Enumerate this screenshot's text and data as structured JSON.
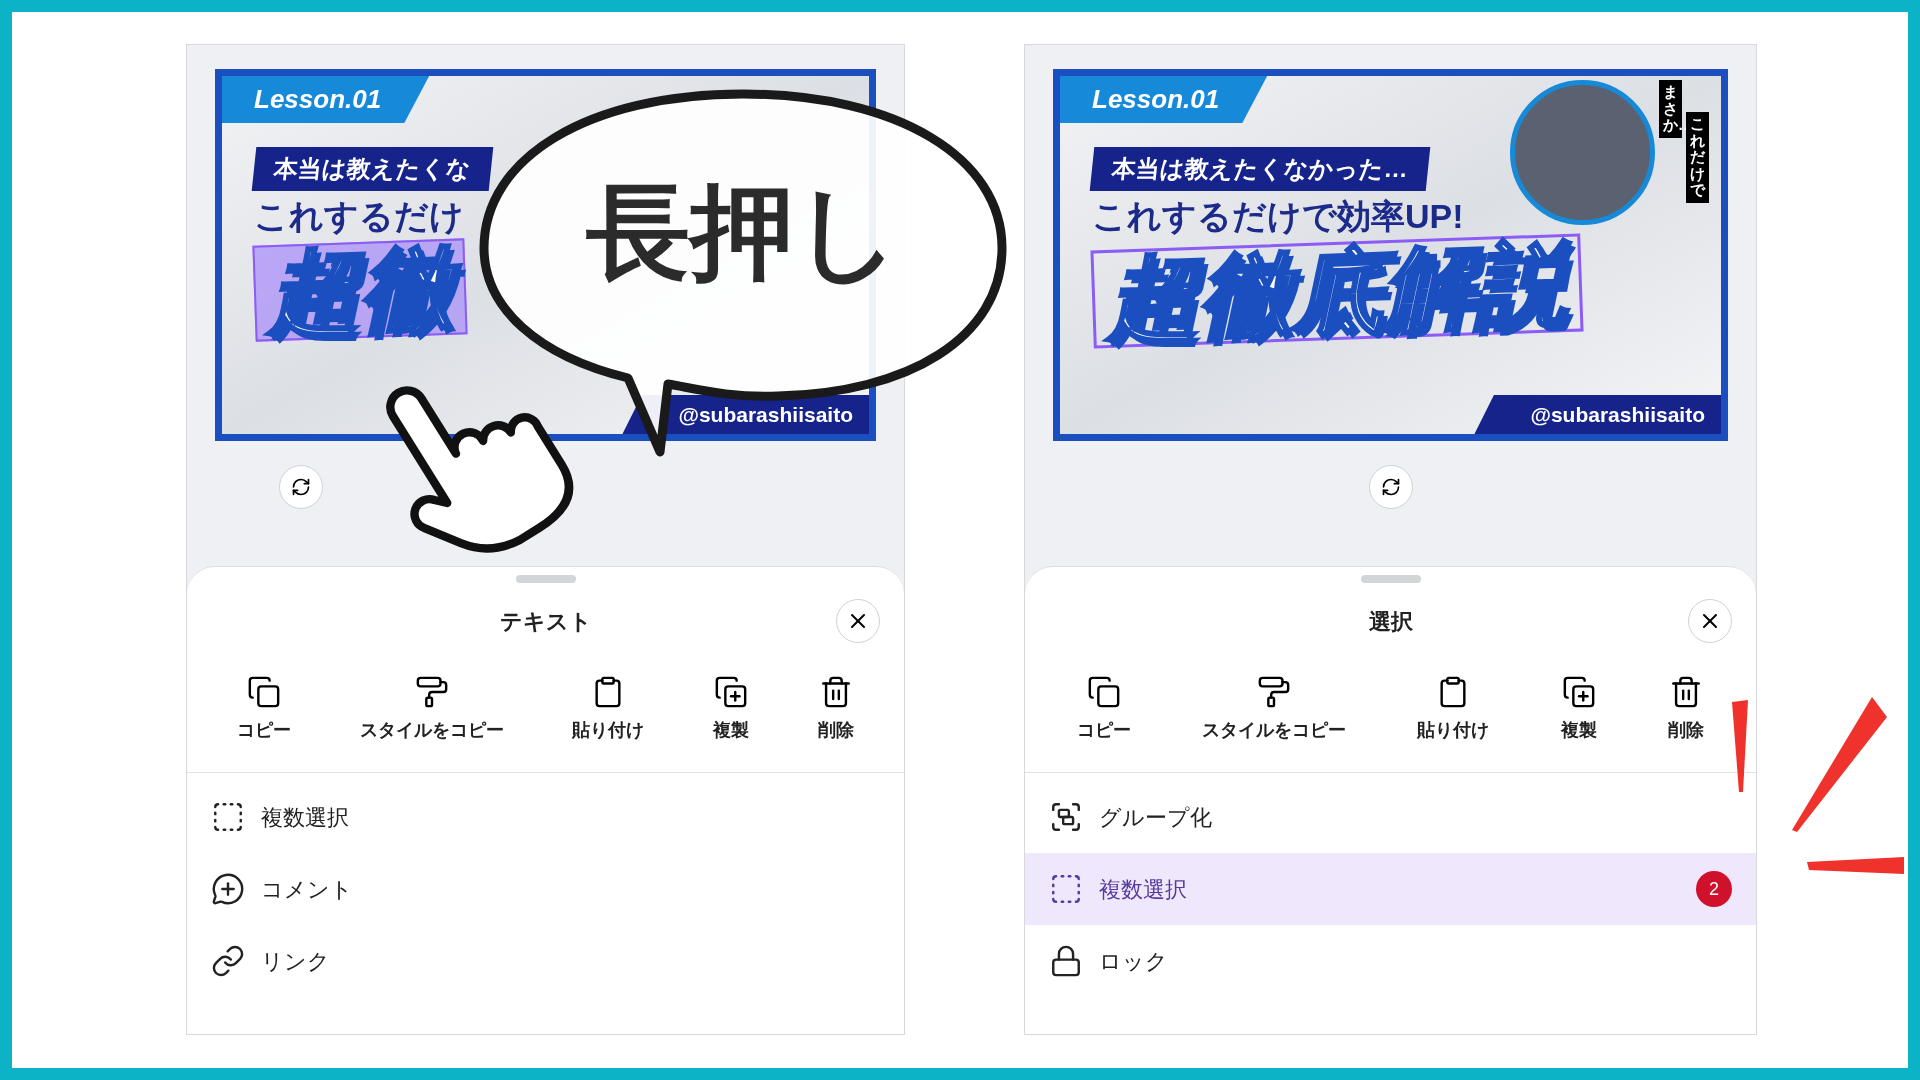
{
  "annotation": {
    "callout": "長押し"
  },
  "panels": [
    {
      "banner": {
        "lesson": "Lesson.01",
        "subtitle": "本当は教えたくな",
        "headline": "これするだけ",
        "title": {
          "text": "超徹",
          "kind": "filled"
        },
        "handle": "@subarashiisaito"
      },
      "sheet": {
        "title": "テキスト",
        "actions": [
          {
            "kind": "copy",
            "label": "コピー"
          },
          {
            "kind": "style",
            "label": "スタイルをコピー"
          },
          {
            "kind": "paste",
            "label": "貼り付け"
          },
          {
            "kind": "duplicate",
            "label": "複製"
          },
          {
            "kind": "delete",
            "label": "削除"
          }
        ],
        "menu": [
          {
            "kind": "multi-select",
            "label": "複数選択",
            "selected": false
          },
          {
            "kind": "comment",
            "label": "コメント",
            "selected": false
          },
          {
            "kind": "link",
            "label": "リンク",
            "selected": false
          }
        ]
      }
    },
    {
      "banner": {
        "lesson": "Lesson.01",
        "subtitle": "本当は教えたくなかった…",
        "headline": "これするだけで効率UP!",
        "title": {
          "text": "超徹底解説",
          "kind": "outline"
        },
        "handle": "@subarashiisaito",
        "photo": true,
        "tags": [
          "まさか…",
          "これだけで"
        ]
      },
      "sheet": {
        "title": "選択",
        "actions": [
          {
            "kind": "copy",
            "label": "コピー"
          },
          {
            "kind": "style",
            "label": "スタイルをコピー"
          },
          {
            "kind": "paste",
            "label": "貼り付け"
          },
          {
            "kind": "duplicate",
            "label": "複製"
          },
          {
            "kind": "delete",
            "label": "削除"
          }
        ],
        "menu": [
          {
            "kind": "group",
            "label": "グループ化",
            "selected": false
          },
          {
            "kind": "multi-select",
            "label": "複数選択",
            "selected": true,
            "badge": "2"
          },
          {
            "kind": "lock",
            "label": "ロック",
            "selected": false
          }
        ]
      }
    }
  ]
}
